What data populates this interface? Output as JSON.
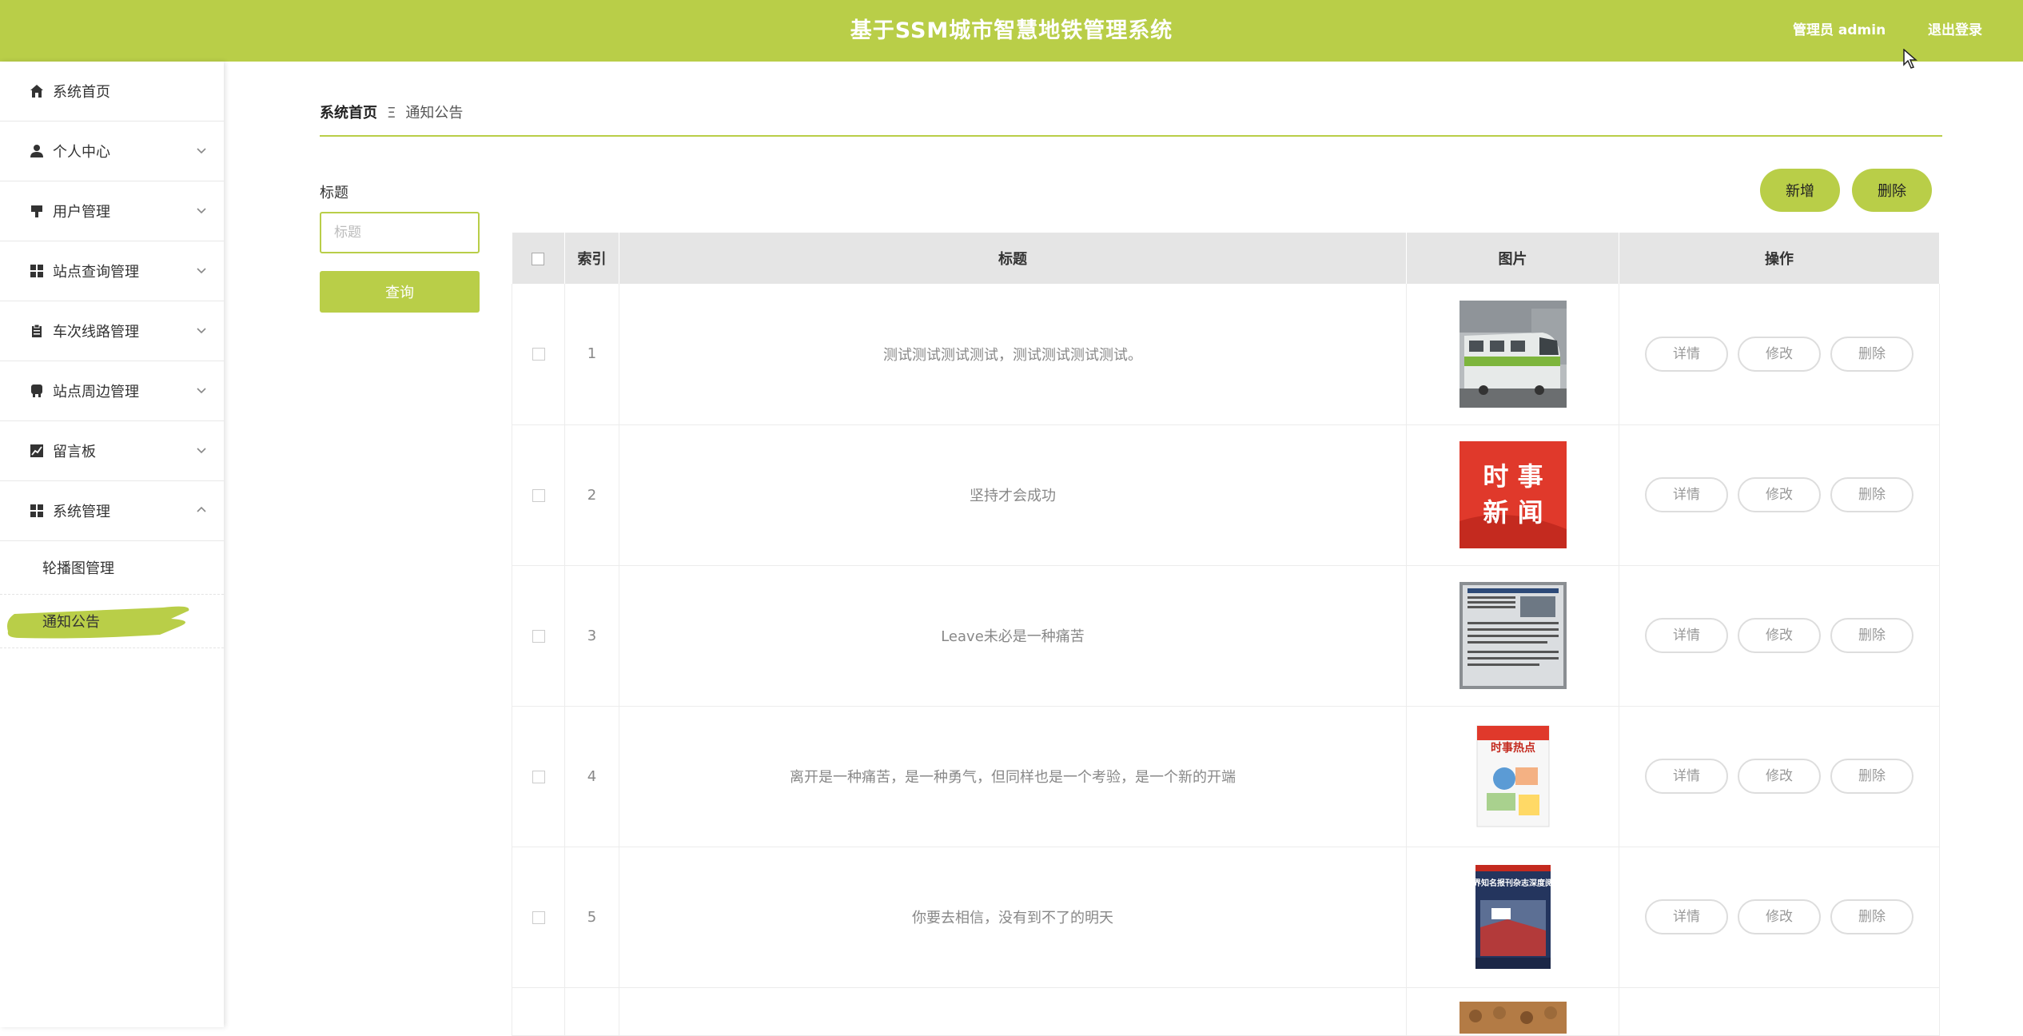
{
  "header": {
    "title": "基于SSM城市智慧地铁管理系统",
    "user_label": "管理员 admin",
    "logout_label": "退出登录"
  },
  "sidebar": {
    "items": [
      {
        "label": "系统首页",
        "icon": "home-icon"
      },
      {
        "label": "个人中心",
        "icon": "person-icon"
      },
      {
        "label": "用户管理",
        "icon": "user-manage-icon"
      },
      {
        "label": "站点查询管理",
        "icon": "grid-icon"
      },
      {
        "label": "车次线路管理",
        "icon": "clipboard-icon"
      },
      {
        "label": "站点周边管理",
        "icon": "train-icon"
      },
      {
        "label": "留言板",
        "icon": "chart-icon"
      },
      {
        "label": "系统管理",
        "icon": "grid-icon"
      }
    ],
    "sub_items": [
      {
        "label": "轮播图管理"
      },
      {
        "label": "通知公告"
      }
    ]
  },
  "breadcrumb": {
    "home": "系统首页",
    "separator": "Ξ",
    "current": "通知公告"
  },
  "search": {
    "label": "标题",
    "placeholder": "标题",
    "button": "查询"
  },
  "actions": {
    "add": "新增",
    "delete": "删除"
  },
  "table": {
    "headers": {
      "index": "索引",
      "title": "标题",
      "image": "图片",
      "ops": "操作"
    },
    "op_labels": {
      "detail": "详情",
      "edit": "修改",
      "delete": "删除"
    },
    "rows": [
      {
        "index": "1",
        "title": "测试测试测试测试，测试测试测试测试。"
      },
      {
        "index": "2",
        "title": "坚持才会成功",
        "image_text_1": "时 事",
        "image_text_2": "新 闻"
      },
      {
        "index": "3",
        "title": "Leave未必是一种痛苦"
      },
      {
        "index": "4",
        "title": "离开是一种痛苦，是一种勇气，但同样也是一个考验，是一个新的开端",
        "image_text": "时事热点"
      },
      {
        "index": "5",
        "title": "你要去相信，没有到不了的明天",
        "image_text": "世界知名报刊杂志深度阅读"
      }
    ]
  },
  "colors": {
    "accent": "#b9ce48",
    "header_bg": "#e5e5e5"
  }
}
